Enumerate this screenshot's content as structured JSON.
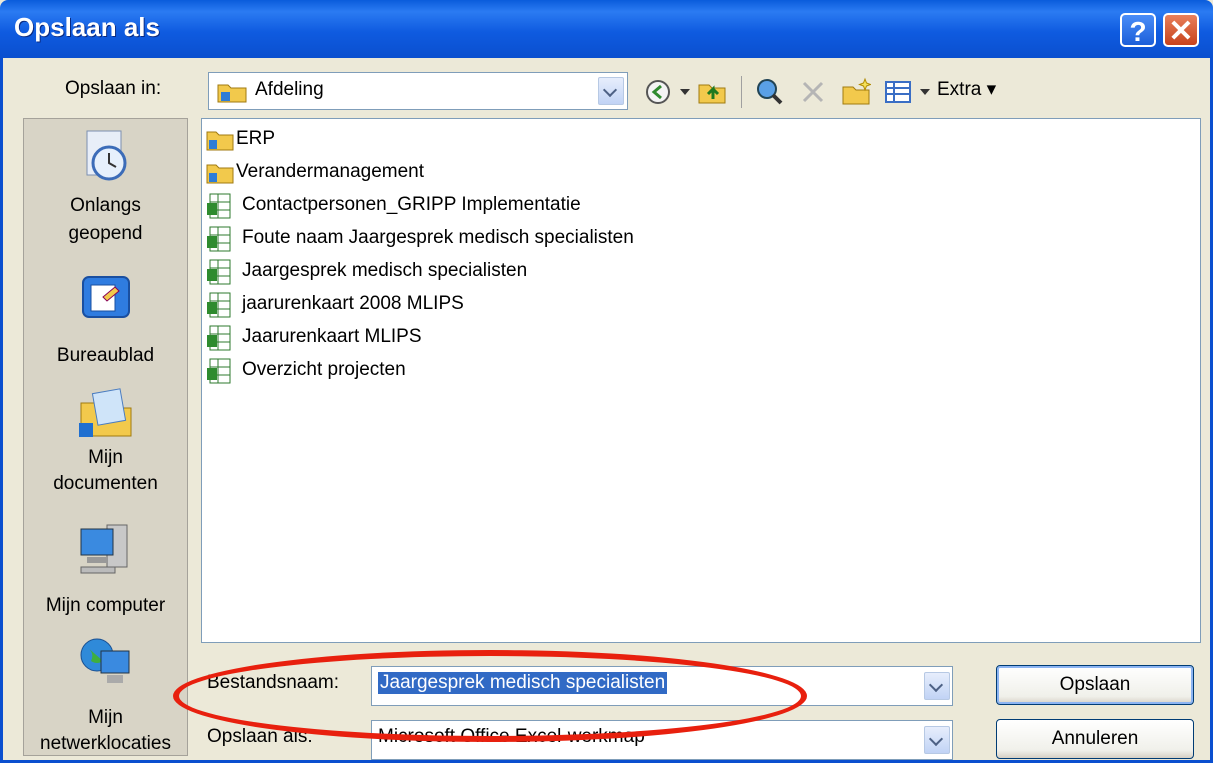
{
  "window": {
    "title": "Opslaan als",
    "help_symbol": "?",
    "close_symbol": "✕"
  },
  "toolbar": {
    "save_in_label": "Opslaan in:",
    "save_in_value": "Afdeling",
    "extra_label": "Extra"
  },
  "places": [
    {
      "label_line1": "Onlangs",
      "label_line2": "geopend",
      "icon": "recent-clock-icon"
    },
    {
      "label_line1": "Bureaublad",
      "label_line2": "",
      "icon": "desktop-icon"
    },
    {
      "label_line1": "Mijn",
      "label_line2": "documenten",
      "icon": "my-documents-icon"
    },
    {
      "label_line1": "Mijn computer",
      "label_line2": "",
      "icon": "my-computer-icon"
    },
    {
      "label_line1": "Mijn",
      "label_line2": "netwerklocaties",
      "icon": "network-places-icon"
    }
  ],
  "files": [
    {
      "name": "ERP",
      "type": "folder"
    },
    {
      "name": "Verandermanagement",
      "type": "folder"
    },
    {
      "name": "Contactpersonen_GRIPP Implementatie",
      "type": "excel"
    },
    {
      "name": "Foute naam Jaargesprek medisch specialisten",
      "type": "excel"
    },
    {
      "name": "Jaargesprek medisch specialisten",
      "type": "excel"
    },
    {
      "name": "jaarurenkaart 2008 MLIPS",
      "type": "excel"
    },
    {
      "name": "Jaarurenkaart MLIPS",
      "type": "excel"
    },
    {
      "name": "Overzicht projecten",
      "type": "excel"
    }
  ],
  "form": {
    "filename_label": "Bestandsnaam:",
    "filename_value": "Jaargesprek medisch specialisten",
    "savetype_label": "Opslaan als:",
    "savetype_value": "Microsoft Office Excel-werkmap",
    "save_button": "Opslaan",
    "cancel_button": "Annuleren"
  },
  "colors": {
    "title_bar": "#0A5CDB",
    "annotation": "#E8200E",
    "selection": "#316AC5"
  }
}
